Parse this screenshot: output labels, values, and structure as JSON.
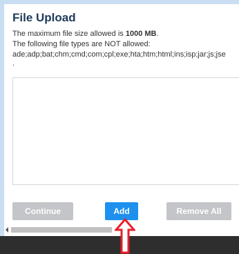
{
  "dialog": {
    "title": "File Upload",
    "size_prefix": "The maximum file size allowed is ",
    "size_value": "1000 MB",
    "size_suffix": ".",
    "types_intro": "The following file types are NOT allowed:",
    "types_list": "ade;adp;bat;chm;cmd;com;cpl;exe;hta;htm;html;ins;isp;jar;js;jse",
    "types_end": "."
  },
  "buttons": {
    "continue": "Continue",
    "add": "Add",
    "remove_all": "Remove All"
  },
  "colors": {
    "primary": "#1e90ee",
    "disabled": "#c3c5c8",
    "annotation": "#e8202a"
  },
  "icons": {
    "scroll_left": "triangle-left",
    "annotation": "up-arrow-outline"
  }
}
